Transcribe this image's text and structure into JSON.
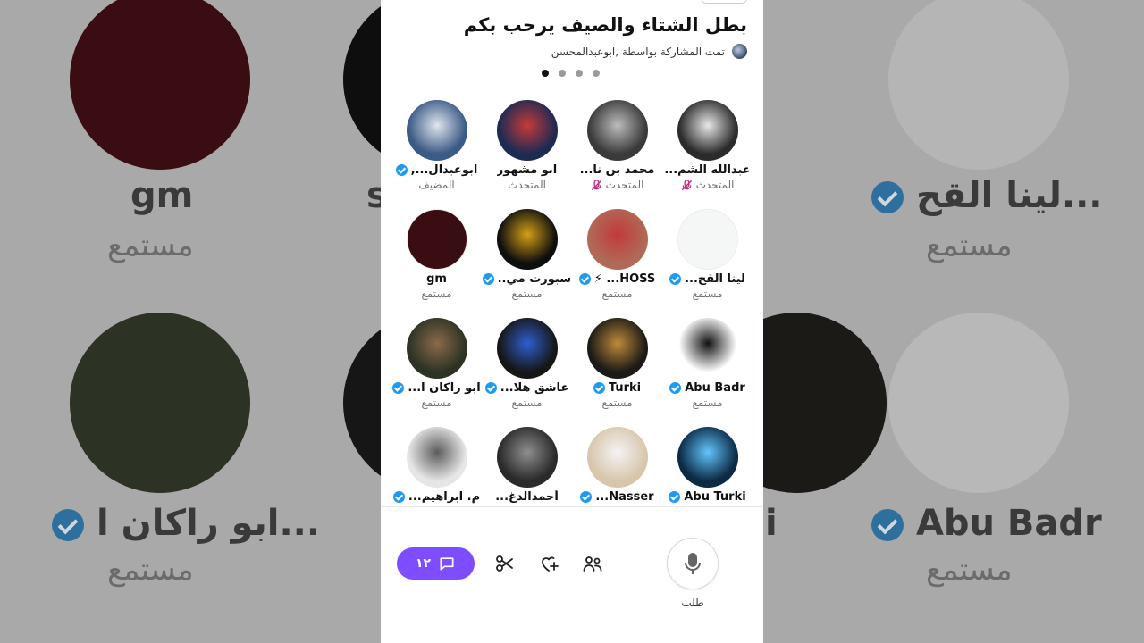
{
  "space": {
    "title": "بطل الشتاء والصيف يرحب بكم",
    "shared_by": "تمت المشاركة بواسطة ,ابوعبدالمحسن",
    "page_dots": [
      true,
      false,
      false,
      false
    ]
  },
  "participants": [
    {
      "name": "عبدالله الشم...",
      "role": "المتحدث",
      "verified": false,
      "muted": true,
      "avatar_color": "#2b2b2b",
      "avatar_accent": "#e8e8e8",
      "icon": "alhilal-logo"
    },
    {
      "name": "محمد بن نا...",
      "role": "المتحدث",
      "verified": false,
      "muted": true,
      "avatar_color": "#3a3a3a",
      "avatar_accent": "#bdbdbd",
      "icon": "person-photo"
    },
    {
      "name": "ابو مشهور",
      "role": "المتحدث",
      "verified": false,
      "muted": false,
      "avatar_color": "#1d2a52",
      "avatar_accent": "#c63a3a",
      "icon": "night-city"
    },
    {
      "name": "ابوعبدال...,",
      "role": "المضيف",
      "verified": true,
      "muted": false,
      "avatar_color": "#3c5a86",
      "avatar_accent": "#dfe6ee",
      "icon": "person-photo"
    },
    {
      "name": "لينا القح...",
      "role": "مستمع",
      "verified": true,
      "muted": false,
      "avatar_color": "#f5f6f6",
      "avatar_accent": "#eef0f0",
      "icon": "blank"
    },
    {
      "name": "HOSS... ⚡",
      "role": "مستمع",
      "verified": true,
      "muted": false,
      "avatar_color": "#b06a57",
      "avatar_accent": "#c23a3a",
      "icon": "person-photo"
    },
    {
      "name": "سبورت مي...",
      "role": "مستمع",
      "verified": true,
      "muted": false,
      "avatar_color": "#0e0e0e",
      "avatar_accent": "#d4a017",
      "icon": "sport-logo"
    },
    {
      "name": "gm",
      "role": "مستمع",
      "verified": false,
      "muted": false,
      "avatar_color": "#3a0d12",
      "avatar_accent": "#5a1a20",
      "icon": "blank"
    },
    {
      "name": "Abu Badr",
      "role": "مستمع",
      "verified": true,
      "muted": false,
      "avatar_color": "#ffffff",
      "avatar_accent": "#111111",
      "icon": "calligraphy"
    },
    {
      "name": "Turki",
      "role": "مستمع",
      "verified": true,
      "muted": false,
      "avatar_color": "#1b1a17",
      "avatar_accent": "#c08a3a",
      "icon": "hands-logo"
    },
    {
      "name": "عاشق هلا...",
      "role": "مستمع",
      "verified": true,
      "muted": false,
      "avatar_color": "#161616",
      "avatar_accent": "#2f5fd0",
      "icon": "alhilal-logo"
    },
    {
      "name": "ابو راكان ا...",
      "role": "مستمع",
      "verified": true,
      "muted": false,
      "avatar_color": "#2d3324",
      "avatar_accent": "#8a6a4a",
      "icon": "person-photo"
    },
    {
      "name": "Abu Turki",
      "role": "",
      "verified": true,
      "muted": false,
      "avatar_color": "#0c2a44",
      "avatar_accent": "#62c6ff",
      "icon": "moon-logo"
    },
    {
      "name": "Nasser...",
      "role": "",
      "verified": true,
      "muted": false,
      "avatar_color": "#d8c6ac",
      "avatar_accent": "#f4f4f4",
      "icon": "person-photo"
    },
    {
      "name": "أحمدالدغ...",
      "role": "",
      "verified": false,
      "muted": false,
      "avatar_color": "#2a2a2a",
      "avatar_accent": "#8f8f8f",
      "icon": "person-photo"
    },
    {
      "name": "م. ابراهيم...",
      "role": "",
      "verified": true,
      "muted": false,
      "avatar_color": "#e6e6e6",
      "avatar_accent": "#5b5b5b",
      "icon": "person-photo"
    }
  ],
  "toolbar": {
    "chat_count": "١٢",
    "chat_icon": "chat-bubble-icon",
    "clip_icon": "scissors-icon",
    "react_icon": "heart-plus-icon",
    "people_icon": "people-icon",
    "request_label": "طلب",
    "request_icon": "microphone-icon"
  },
  "background": {
    "left_name": "gm",
    "left_role": "مستمع",
    "right_name": "لينا القح...",
    "right_role": "مستمع",
    "left_name_2": "ابو راكان ا...",
    "left_role_2": "مستمع",
    "right_name_2": "Abu Badr",
    "right_role_2": "مستمع",
    "frag_name": "ss...",
    "frag_name_2": "i"
  },
  "colors": {
    "accent": "#7d4dff",
    "verified": "#1d9bf0",
    "muted": "#c0257a"
  }
}
